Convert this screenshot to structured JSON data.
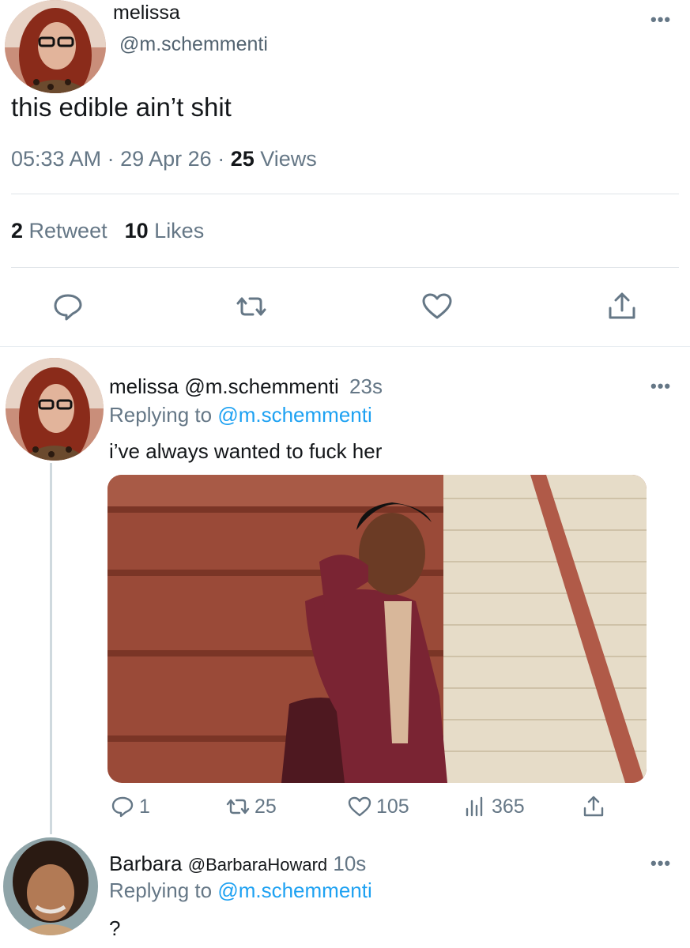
{
  "main_tweet": {
    "author_name": "melissa",
    "author_handle": "@m.schemmenti",
    "more": "•••",
    "text": "this edible ain’t shit",
    "time": "05:33 AM",
    "date": "29 Apr 26",
    "views_count": "25",
    "views_label": "Views",
    "retweets_count": "2",
    "retweets_label": "Retweet",
    "likes_count": "10",
    "likes_label": "Likes",
    "actions": [
      "reply-icon",
      "retweet-icon",
      "like-icon",
      "share-icon"
    ]
  },
  "reply_1": {
    "author_name": "melissa",
    "author_handle": "@m.schemmenti",
    "time": "23s",
    "replying_label": "Replying to",
    "replying_to": "@m.schemmenti",
    "text": "i’ve always wanted to fuck her",
    "more": "•••",
    "reply_count": "1",
    "retweet_count": "25",
    "like_count": "105",
    "views_count": "365"
  },
  "reply_2": {
    "author_name": "Barbara",
    "author_handle": "@BarbaraHoward",
    "time": "10s",
    "replying_label": "Replying to",
    "replying_to": "@m.schemmenti",
    "text": "?",
    "more": "•••"
  },
  "colors": {
    "link": "#1da1f2",
    "secondary_text": "#657786",
    "primary_text": "#14171a"
  }
}
